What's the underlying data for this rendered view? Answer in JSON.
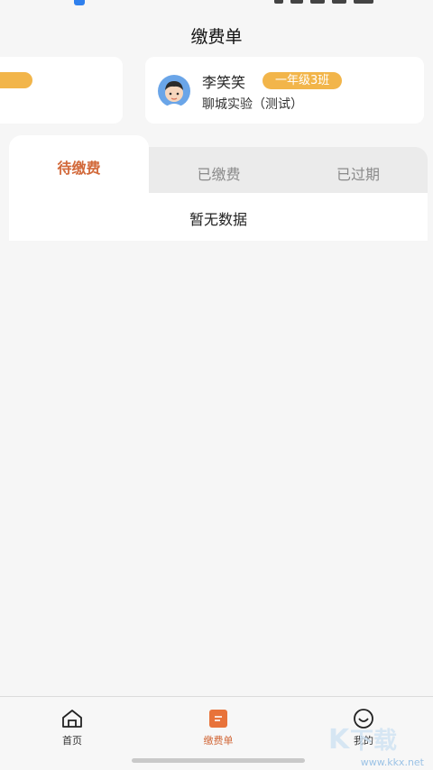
{
  "header": {
    "title": "缴费单"
  },
  "student": {
    "name": "李笑笑",
    "class": "一年级3班",
    "school": "聊城实验（测试）"
  },
  "tabs": [
    {
      "label": "待缴费",
      "active": true
    },
    {
      "label": "已缴费",
      "active": false
    },
    {
      "label": "已过期",
      "active": false
    }
  ],
  "content": {
    "empty_text": "暂无数据"
  },
  "bottom_nav": [
    {
      "label": "首页",
      "icon": "home-icon"
    },
    {
      "label": "缴费单",
      "icon": "bill-icon",
      "active": true
    },
    {
      "label": "我的",
      "icon": "profile-icon"
    }
  ],
  "watermark": {
    "url": "www.kkx.net"
  },
  "colors": {
    "accent": "#d2693a",
    "badge": "#f2b54a",
    "background": "#f6f6f6"
  }
}
